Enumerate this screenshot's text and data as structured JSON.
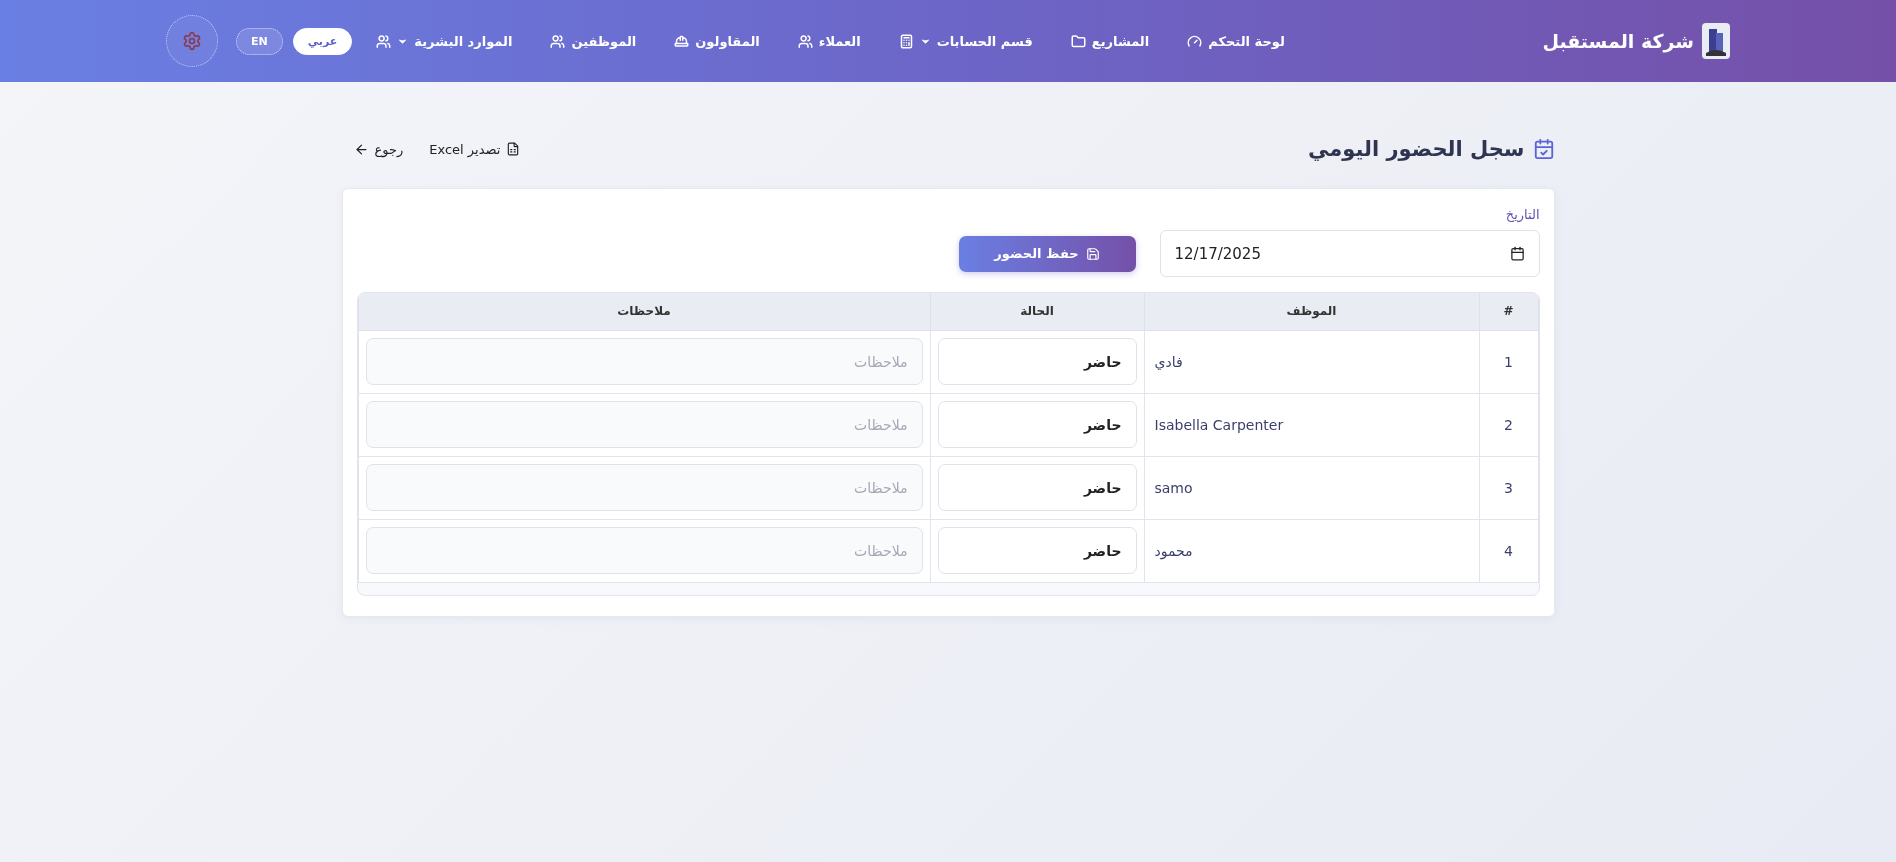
{
  "navbar": {
    "brand": "شركة المستقبل",
    "items": [
      {
        "label": "لوحة التحكم",
        "dropdown": false
      },
      {
        "label": "المشاريع",
        "dropdown": false
      },
      {
        "label": "قسم الحسابات",
        "dropdown": true
      },
      {
        "label": "العملاء",
        "dropdown": false
      },
      {
        "label": "المقاولون",
        "dropdown": false
      },
      {
        "label": "الموظفين",
        "dropdown": false
      },
      {
        "label": "الموارد البشرية",
        "dropdown": true
      }
    ],
    "languages": [
      {
        "label": "عربي",
        "selected": true
      },
      {
        "label": "EN",
        "selected": false
      }
    ]
  },
  "page": {
    "title": "سجل الحضور اليومي",
    "actions": [
      {
        "label": "تصدير Excel"
      },
      {
        "label": "رجوع"
      }
    ]
  },
  "form": {
    "date_label": "التاريخ",
    "date_value": "12/17/2025",
    "save_button": "حفظ الحضور"
  },
  "table": {
    "columns": [
      "#",
      "الموظف",
      "الحالة",
      "ملاحظات"
    ],
    "rows": [
      {
        "number": "1",
        "employee": "فادي",
        "status": "حاضر",
        "notes_placeholder": "ملاحظات"
      },
      {
        "number": "2",
        "employee": "Isabella Carpenter",
        "status": "حاضر",
        "notes_placeholder": "ملاحظات"
      },
      {
        "number": "3",
        "employee": "samo",
        "status": "حاضر",
        "notes_placeholder": "ملاحظات"
      },
      {
        "number": "4",
        "employee": "محمود",
        "status": "حاضر",
        "notes_placeholder": "ملاحظات"
      }
    ]
  }
}
